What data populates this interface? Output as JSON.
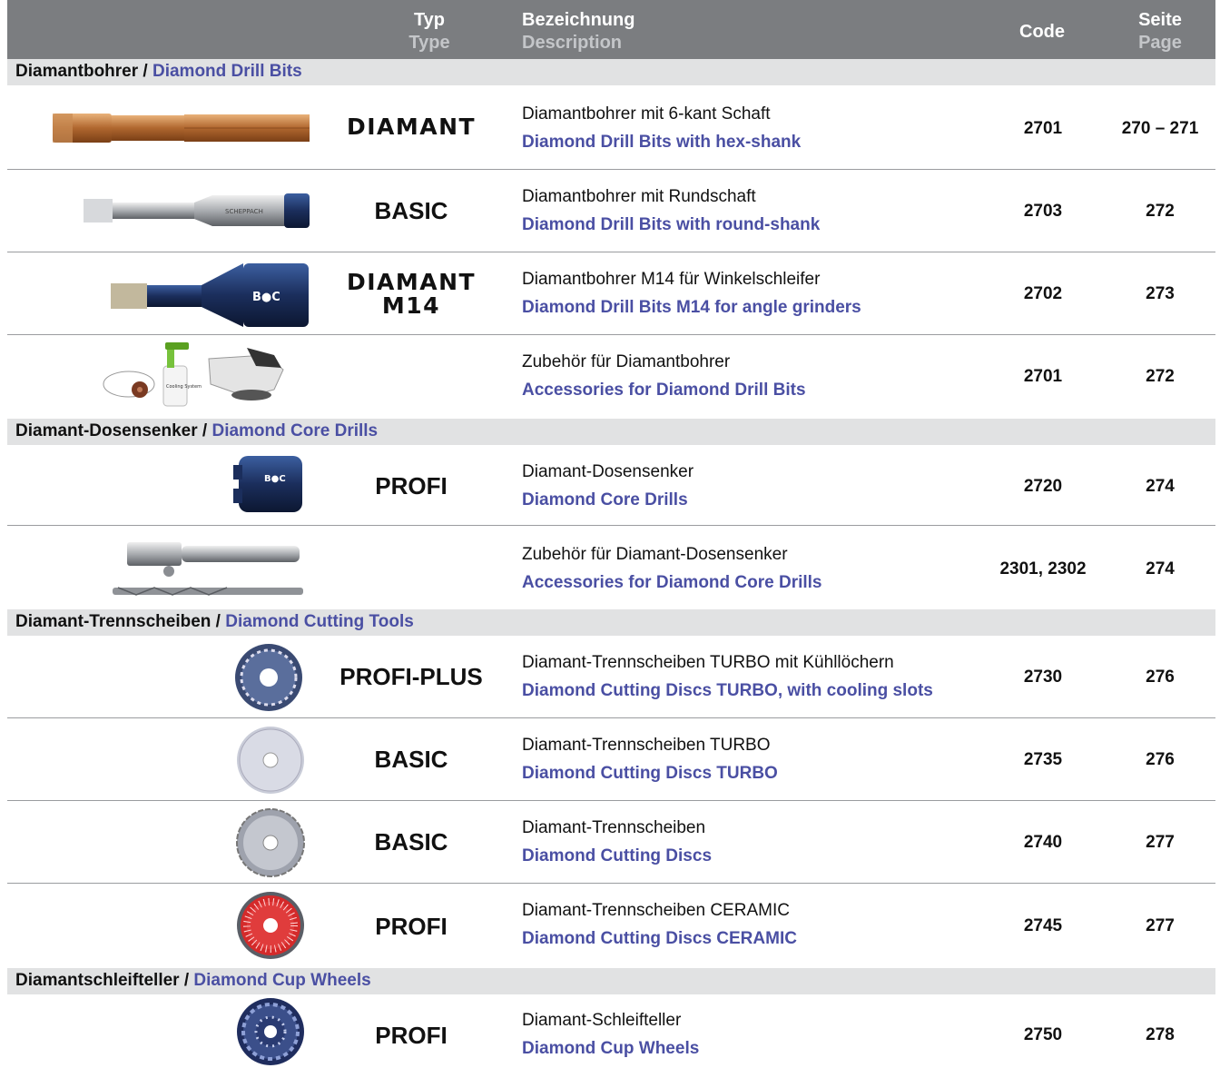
{
  "header": {
    "type_de": "Typ",
    "type_en": "Type",
    "desc_de": "Bezeichnung",
    "desc_en": "Description",
    "code": "Code",
    "page_de": "Seite",
    "page_en": "Page"
  },
  "sections": [
    {
      "de": "Diamantbohrer / ",
      "en": "Diamond Drill Bits"
    },
    {
      "de": "Diamant-Dosensenker / ",
      "en": "Diamond Core Drills"
    },
    {
      "de": "Diamant-Trennscheiben / ",
      "en": "Diamond Cutting Tools"
    },
    {
      "de": "Diamantschleifteller / ",
      "en": "Diamond Cup Wheels"
    }
  ],
  "rows": [
    {
      "type": "DIAMANT",
      "type2": "",
      "de": "Diamantbohrer mit 6-kant Schaft",
      "en": "Diamond Drill Bits with hex-shank",
      "code": "2701",
      "page": "270 – 271",
      "image": "hex-shank-drill-bit"
    },
    {
      "type": "BASIC",
      "type2": "",
      "de": "Diamantbohrer mit Rundschaft",
      "en": "Diamond Drill Bits with round-shank",
      "code": "2703",
      "page": "272",
      "image": "round-shank-drill-bit",
      "img_text": "SCHEPPACH"
    },
    {
      "type": "DIAMANT",
      "type2": "M14",
      "de": "Diamantbohrer M14 für Winkelschleifer",
      "en": "Diamond Drill Bits M14 for angle grinders",
      "code": "2702",
      "page": "273",
      "image": "m14-drill-bit",
      "img_text": "B●C"
    },
    {
      "type": "",
      "type2": "",
      "de": "Zubehör für Diamantbohrer",
      "en": "Accessories for Diamond Drill Bits",
      "code": "2701",
      "page": "272",
      "image": "cooling-accessories",
      "img_text": "Cooling System"
    },
    {
      "type": "PROFI",
      "type2": "",
      "de": "Diamant-Dosensenker",
      "en": "Diamond Core Drills",
      "code": "2720",
      "page": "274",
      "image": "core-drill",
      "img_text": "B●C"
    },
    {
      "type": "",
      "type2": "",
      "de": "Zubehör für Diamant-Dosensenker",
      "en": "Accessories for Diamond Core Drills",
      "code": "2301, 2302",
      "page": "274",
      "image": "core-drill-adapter"
    },
    {
      "type": "PROFI-PLUS",
      "type2": "",
      "de": "Diamant-Trennscheiben TURBO mit Kühllöchern",
      "en": "Diamond Cutting Discs TURBO, with cooling slots",
      "code": "2730",
      "page": "276",
      "image": "turbo-disc-cooling"
    },
    {
      "type": "BASIC",
      "type2": "",
      "de": "Diamant-Trennscheiben TURBO",
      "en": "Diamond Cutting Discs TURBO",
      "code": "2735",
      "page": "276",
      "image": "turbo-disc"
    },
    {
      "type": "BASIC",
      "type2": "",
      "de": "Diamant-Trennscheiben",
      "en": "Diamond Cutting Discs",
      "code": "2740",
      "page": "277",
      "image": "segmented-disc"
    },
    {
      "type": "PROFI",
      "type2": "",
      "de": "Diamant-Trennscheiben CERAMIC",
      "en": "Diamond Cutting Discs CERAMIC",
      "code": "2745",
      "page": "277",
      "image": "ceramic-disc"
    },
    {
      "type": "PROFI",
      "type2": "",
      "de": "Diamant-Schleifteller",
      "en": "Diamond Cup Wheels",
      "code": "2750",
      "page": "278",
      "image": "cup-wheel"
    }
  ],
  "colors": {
    "header_bg": "#7b7d80",
    "section_bg": "#e1e2e3",
    "english_text": "#4a4fa3"
  }
}
